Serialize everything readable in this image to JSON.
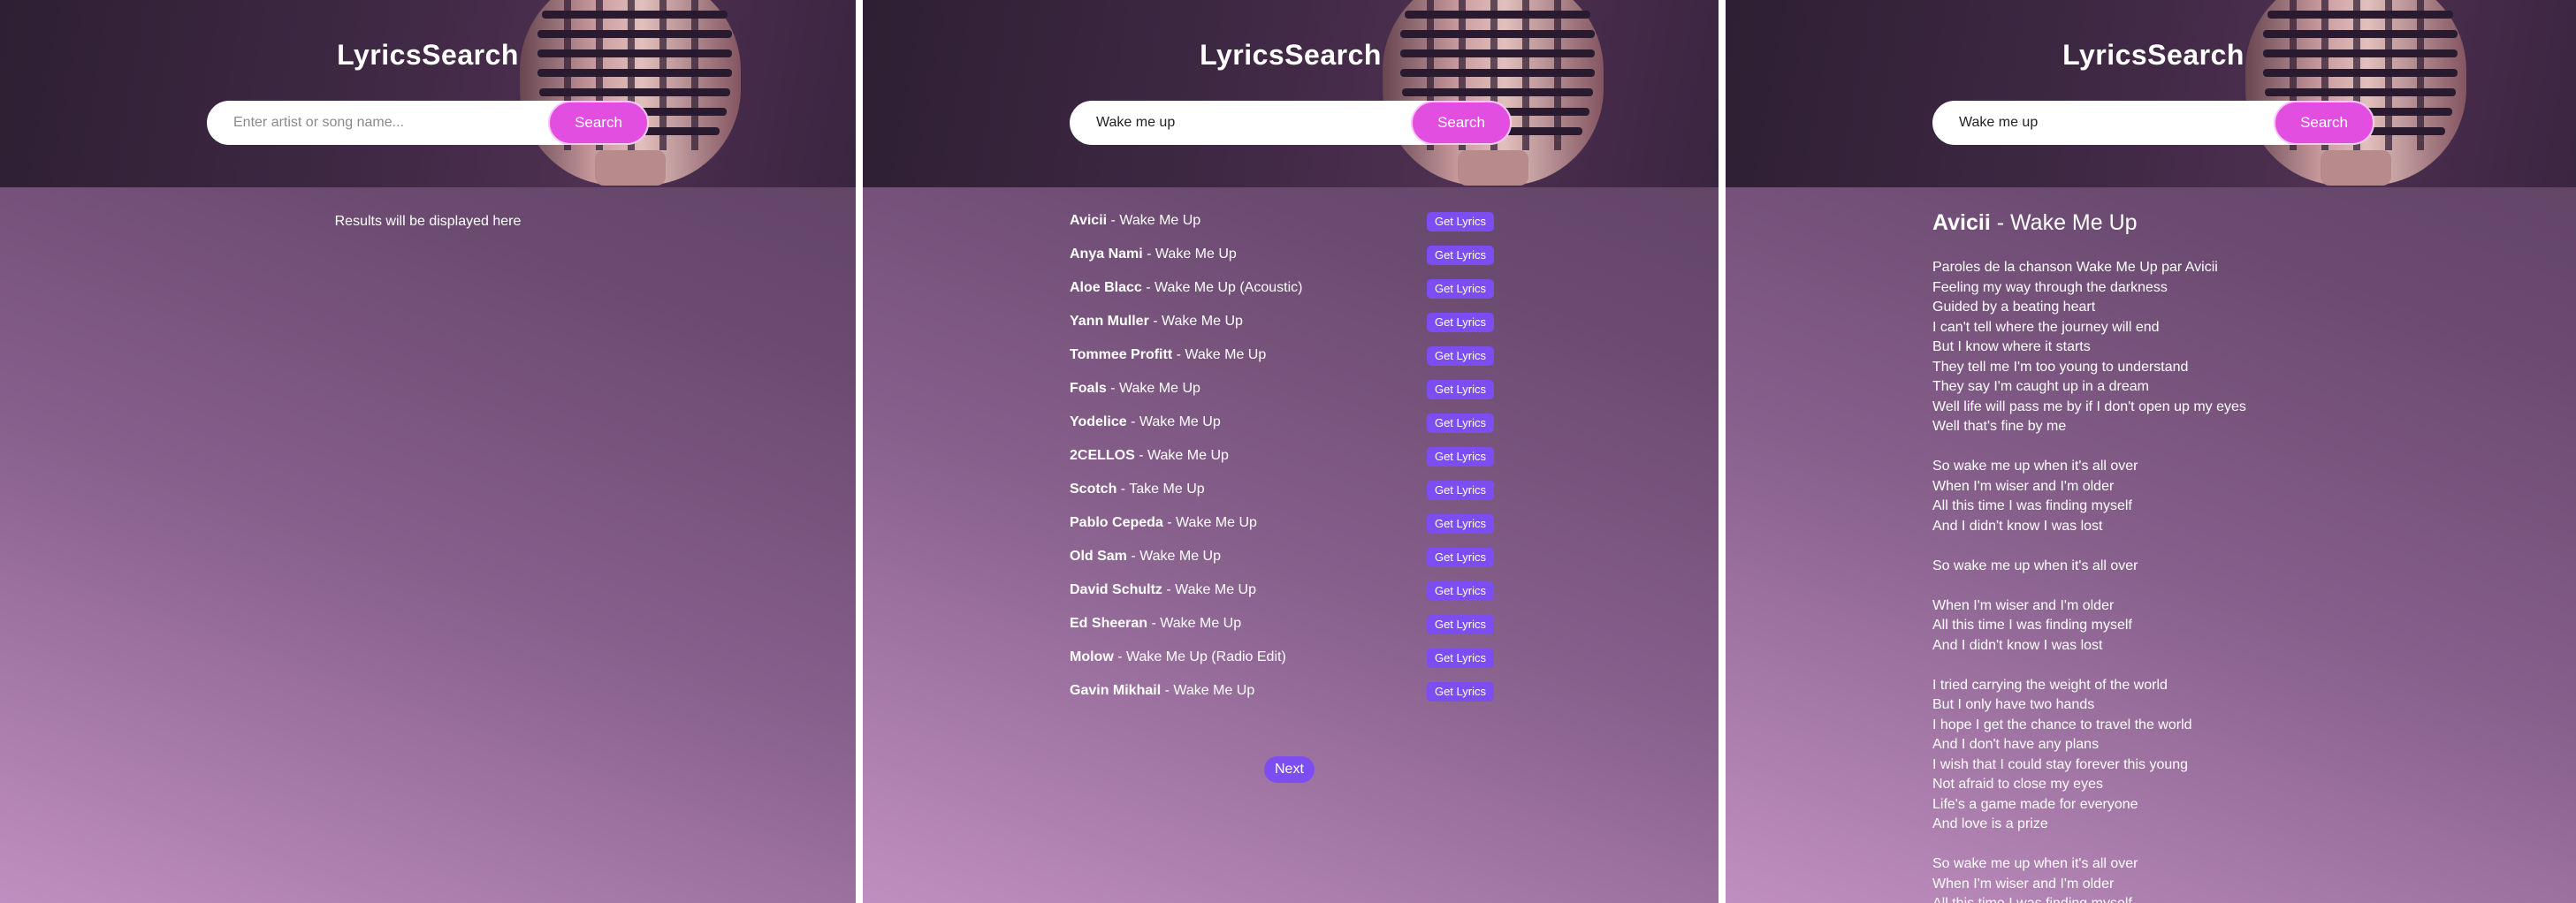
{
  "app": {
    "title": "LyricsSearch"
  },
  "search": {
    "placeholder": "Enter artist or song name...",
    "button_label": "Search",
    "query": "Wake me up"
  },
  "empty_state": {
    "message": "Results will be displayed here"
  },
  "results": {
    "button_label": "Get Lyrics",
    "separator": " - ",
    "items": [
      {
        "artist": "Avicii",
        "title": "Wake Me Up"
      },
      {
        "artist": "Anya Nami",
        "title": "Wake Me Up"
      },
      {
        "artist": "Aloe Blacc",
        "title": "Wake Me Up (Acoustic)"
      },
      {
        "artist": "Yann Muller",
        "title": "Wake Me Up"
      },
      {
        "artist": "Tommee Profitt",
        "title": "Wake Me Up"
      },
      {
        "artist": "Foals",
        "title": "Wake Me Up"
      },
      {
        "artist": "Yodelice",
        "title": "Wake Me Up"
      },
      {
        "artist": "2CELLOS",
        "title": "Wake Me Up"
      },
      {
        "artist": "Scotch",
        "title": "Take Me Up"
      },
      {
        "artist": "Pablo Cepeda",
        "title": "Wake Me Up"
      },
      {
        "artist": "Old Sam",
        "title": "Wake Me Up"
      },
      {
        "artist": "David Schultz",
        "title": "Wake Me Up"
      },
      {
        "artist": "Ed Sheeran",
        "title": "Wake Me Up"
      },
      {
        "artist": "Molow",
        "title": "Wake Me Up (Radio Edit)"
      },
      {
        "artist": "Gavin Mikhail",
        "title": "Wake Me Up"
      }
    ],
    "next_label": "Next"
  },
  "lyrics_view": {
    "artist": "Avicii",
    "separator": " - ",
    "title": "Wake Me Up",
    "lines": [
      "Paroles de la chanson Wake Me Up par Avicii",
      "Feeling my way through the darkness",
      "Guided by a beating heart",
      "I can't tell where the journey will end",
      "But I know where it starts",
      "They tell me I'm too young to understand",
      "They say I'm caught up in a dream",
      "Well life will pass me by if I don't open up my eyes",
      "Well that's fine by me",
      "",
      "So wake me up when it's all over",
      "When I'm wiser and I'm older",
      "All this time I was finding myself",
      "And I didn't know I was lost",
      "",
      "So wake me up when it's all over",
      "",
      "When I'm wiser and I'm older",
      "All this time I was finding myself",
      "And I didn't know I was lost",
      "",
      "I tried carrying the weight of the world",
      "But I only have two hands",
      "I hope I get the chance to travel the world",
      "And I don't have any plans",
      "I wish that I could stay forever this young",
      "Not afraid to close my eyes",
      "Life's a game made for everyone",
      "And love is a prize",
      "",
      "So wake me up when it's all over",
      "When I'm wiser and I'm older",
      "All this time I was finding myself"
    ]
  },
  "colors": {
    "accent_pink": "#e14ee0",
    "accent_purple": "#7c4df1"
  },
  "icons": {
    "header_image": "microphone-icon"
  }
}
